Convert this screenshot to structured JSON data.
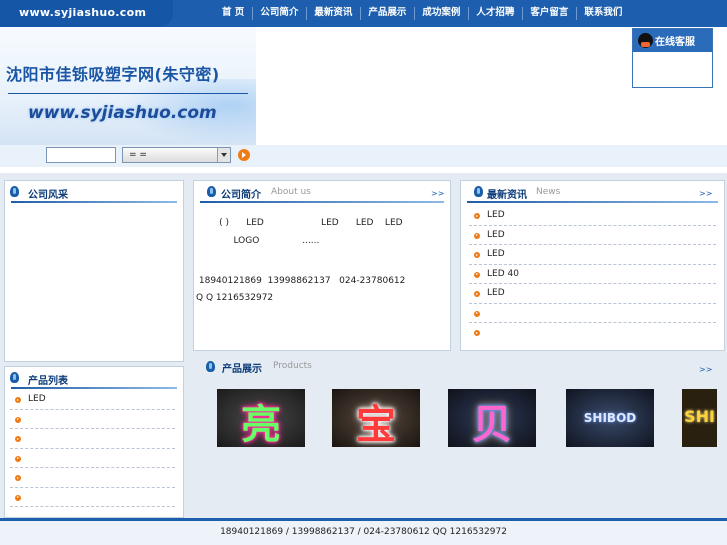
{
  "nav": {
    "logo": "www.syjiashuo.com",
    "items": [
      "首 页",
      "公司简介",
      "最新资讯",
      "产品展示",
      "成功案例",
      "人才招聘",
      "客户留言",
      "联系我们"
    ]
  },
  "banner": {
    "title": "沈阳市佳铄吸塑字网(朱守密)",
    "url": "www.syjiashuo.com"
  },
  "service_widget": {
    "label": "在线客服"
  },
  "search": {
    "input_value": "",
    "select_value": "= ="
  },
  "company_style": {
    "title": "公司风采"
  },
  "product_list": {
    "title": "产品列表",
    "items": [
      "LED",
      "",
      "",
      "",
      "",
      ""
    ]
  },
  "about": {
    "title": "公司简介",
    "subtitle": "About us",
    "more": ">>",
    "lines": [
      "      ( )      LED                    LED      LED    LED",
      "           LOGO               ......",
      "",
      " 18940121869  13998862137   024-23780612",
      "Q Q 1216532972"
    ]
  },
  "news": {
    "title": "最新资讯",
    "subtitle": "News",
    "more": ">>",
    "items": [
      "LED",
      "  LED",
      "LED",
      "LED      40",
      "LED",
      "",
      ""
    ]
  },
  "products": {
    "title": "产品展示",
    "subtitle": "Products",
    "more": ">>",
    "items": [
      "亮",
      "宝",
      "贝",
      "SHIBOD",
      "SHI"
    ]
  },
  "footer": {
    "text": "18940121869 / 13998862137 / 024-23780612   QQ 1216532972"
  }
}
